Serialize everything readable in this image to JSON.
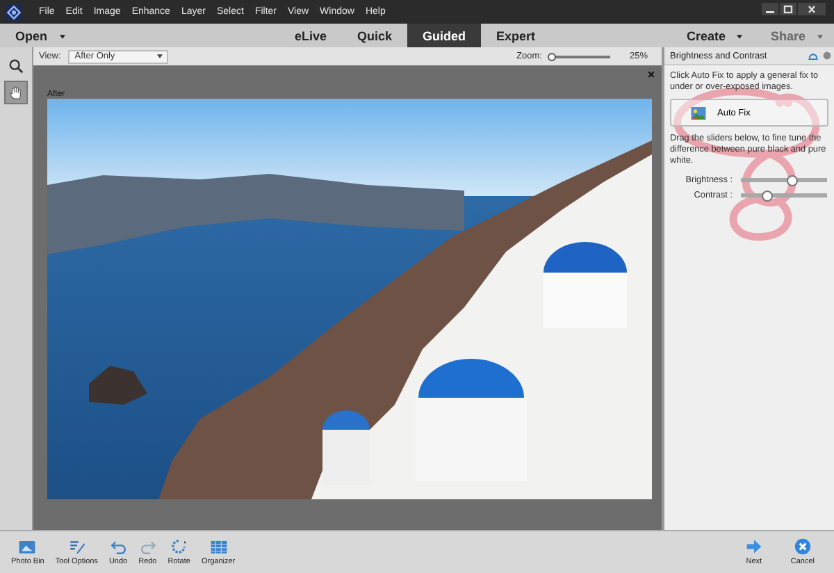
{
  "menu": [
    "File",
    "Edit",
    "Image",
    "Enhance",
    "Layer",
    "Select",
    "Filter",
    "View",
    "Window",
    "Help"
  ],
  "mode_bar": {
    "open": "Open",
    "tabs": [
      {
        "label": "eLive",
        "selected": false
      },
      {
        "label": "Quick",
        "selected": false
      },
      {
        "label": "Guided",
        "selected": true
      },
      {
        "label": "Expert",
        "selected": false
      }
    ],
    "create": "Create",
    "share": "Share"
  },
  "view_bar": {
    "view_label": "View:",
    "view_value": "After Only",
    "zoom_label": "Zoom:",
    "zoom": {
      "level": 0.05
    },
    "zoom_reading": "25%"
  },
  "tools": [
    {
      "kind": "zoom",
      "selected": false
    },
    {
      "kind": "hand",
      "selected": true
    }
  ],
  "canvas": {
    "label": "After"
  },
  "panel": {
    "title": "Brightness and Contrast",
    "intro": "Click Auto Fix to apply a general fix to under or over-exposed images.",
    "auto_fix": "Auto Fix",
    "instructions": "Drag the sliders below, to fine tune the difference between pure black and pure white.",
    "sliders": [
      {
        "label": "Brightness :",
        "level": 0.6
      },
      {
        "label": "Contrast :",
        "level": 0.3
      }
    ]
  },
  "bottom_bar": [
    {
      "kind": "photo-bin",
      "label": "Photo Bin"
    },
    {
      "kind": "tool-options",
      "label": "Tool Options"
    },
    {
      "kind": "undo",
      "label": "Undo"
    },
    {
      "kind": "redo",
      "label": "Redo"
    },
    {
      "kind": "rotate",
      "label": "Rotate"
    },
    {
      "kind": "organizer",
      "label": "Organizer"
    }
  ],
  "footer_buttons": [
    {
      "kind": "next",
      "label": "Next"
    },
    {
      "kind": "cancel",
      "label": "Cancel"
    }
  ]
}
